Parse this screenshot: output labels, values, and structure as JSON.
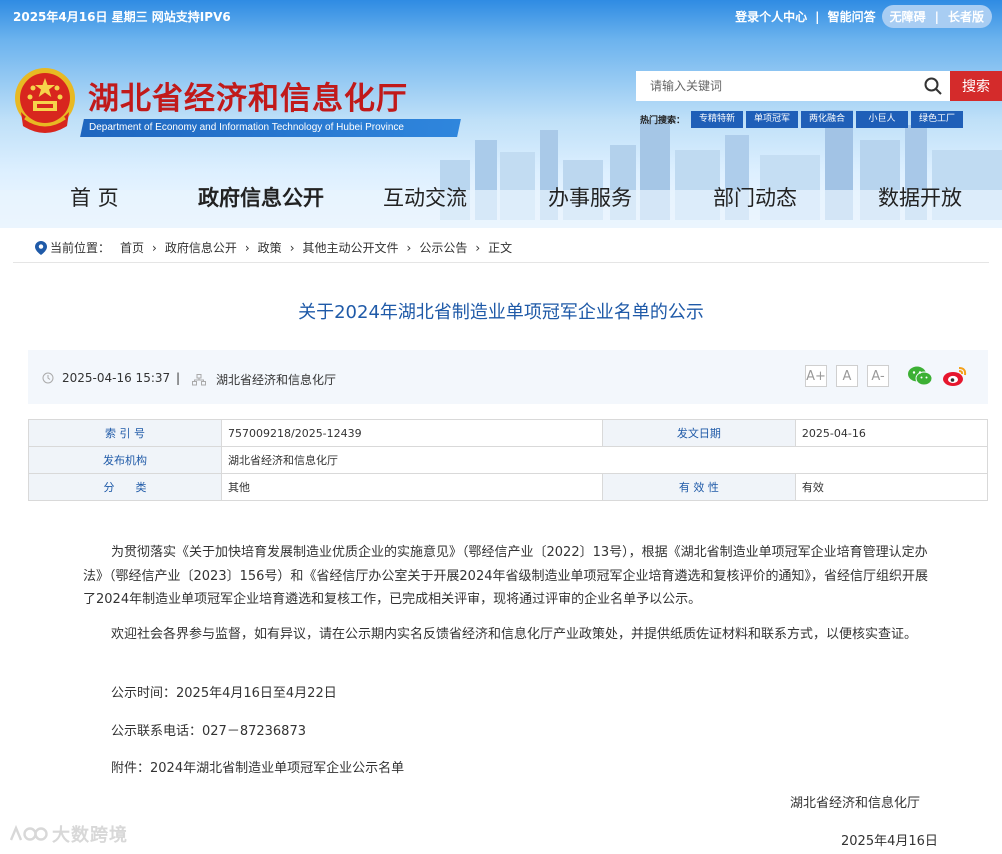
{
  "topbar": {
    "date": "2025年4月16日 星期三   网站支持IPV6",
    "login": "登录个人中心",
    "faq": "智能问答",
    "accessible": "无障碍",
    "elder": "长者版"
  },
  "site": {
    "title": "湖北省经济和信息化厅",
    "subtitle": "Department of Economy and Information Technology of Hubei Province"
  },
  "search": {
    "placeholder": "请输入关键词",
    "button": "搜索",
    "hot_label": "热门搜索：",
    "hot_tags": [
      "专精特新",
      "单项冠军",
      "两化融合",
      "小巨人",
      "绿色工厂"
    ]
  },
  "nav": [
    "首  页",
    "政府信息公开",
    "互动交流",
    "办事服务",
    "部门动态",
    "数据开放"
  ],
  "breadcrumb": {
    "label": "当前位置：",
    "items": [
      "首页",
      "政府信息公开",
      "政策",
      "其他主动公开文件",
      "公示公告",
      "正文"
    ]
  },
  "article": {
    "title": "关于2024年湖北省制造业单项冠军企业名单的公示",
    "datetime": "2025-04-16 15:37",
    "source": "湖北省经济和信息化厅",
    "font_buttons": [
      "A+",
      "A",
      "A-"
    ]
  },
  "info": {
    "index_label": "索 引 号",
    "index_value": "757009218/2025-12439",
    "date_label": "发文日期",
    "date_value": "2025-04-16",
    "issuer_label": "发布机构",
    "issuer_value": "湖北省经济和信息化厅",
    "category_label": "分      类",
    "category_value": "其他",
    "validity_label": "有 效 性",
    "validity_value": "有效"
  },
  "body": {
    "p1": "为贯彻落实《关于加快培育发展制造业优质企业的实施意见》（鄂经信产业〔2022〕13号），根据《湖北省制造业单项冠军企业培育管理认定办法》（鄂经信产业〔2023〕156号）和《省经信厅办公室关于开展2024年省级制造业单项冠军企业培育遴选和复核评价的通知》，省经信厅组织开展了2024年制造业单项冠军企业培育遴选和复核工作，已完成相关评审，现将通过评审的企业名单予以公示。",
    "p2": "欢迎社会各界参与监督，如有异议，请在公示期内实名反馈省经济和信息化厅产业政策处，并提供纸质佐证材料和联系方式，以便核实查证。",
    "period": "公示时间：2025年4月16日至4月22日",
    "phone": "公示联系电话：027－87236873",
    "attachment": "附件：2024年湖北省制造业单项冠军企业公示名单",
    "sign_org": "湖北省经济和信息化厅",
    "sign_date": "2025年4月16日"
  },
  "watermark": "大数跨境",
  "colors": {
    "brand_red": "#c11a1a",
    "brand_blue": "#1f5aa8",
    "search_red": "#d42b2b"
  }
}
